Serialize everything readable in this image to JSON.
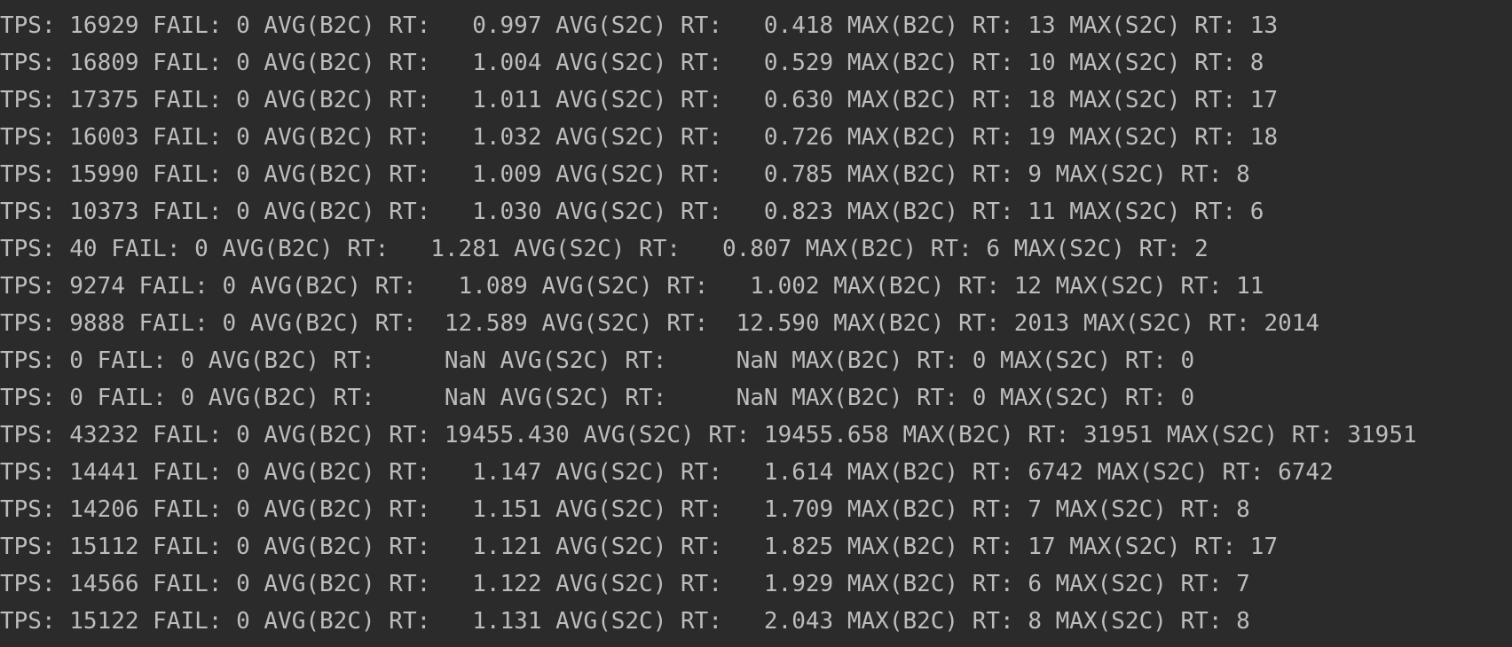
{
  "log": {
    "lines": [
      "TPS: 16929 FAIL: 0 AVG(B2C) RT:   0.997 AVG(S2C) RT:   0.418 MAX(B2C) RT: 13 MAX(S2C) RT: 13",
      "TPS: 16809 FAIL: 0 AVG(B2C) RT:   1.004 AVG(S2C) RT:   0.529 MAX(B2C) RT: 10 MAX(S2C) RT: 8",
      "TPS: 17375 FAIL: 0 AVG(B2C) RT:   1.011 AVG(S2C) RT:   0.630 MAX(B2C) RT: 18 MAX(S2C) RT: 17",
      "TPS: 16003 FAIL: 0 AVG(B2C) RT:   1.032 AVG(S2C) RT:   0.726 MAX(B2C) RT: 19 MAX(S2C) RT: 18",
      "TPS: 15990 FAIL: 0 AVG(B2C) RT:   1.009 AVG(S2C) RT:   0.785 MAX(B2C) RT: 9 MAX(S2C) RT: 8",
      "TPS: 10373 FAIL: 0 AVG(B2C) RT:   1.030 AVG(S2C) RT:   0.823 MAX(B2C) RT: 11 MAX(S2C) RT: 6",
      "TPS: 40 FAIL: 0 AVG(B2C) RT:   1.281 AVG(S2C) RT:   0.807 MAX(B2C) RT: 6 MAX(S2C) RT: 2",
      "TPS: 9274 FAIL: 0 AVG(B2C) RT:   1.089 AVG(S2C) RT:   1.002 MAX(B2C) RT: 12 MAX(S2C) RT: 11",
      "TPS: 9888 FAIL: 0 AVG(B2C) RT:  12.589 AVG(S2C) RT:  12.590 MAX(B2C) RT: 2013 MAX(S2C) RT: 2014",
      "TPS: 0 FAIL: 0 AVG(B2C) RT:     NaN AVG(S2C) RT:     NaN MAX(B2C) RT: 0 MAX(S2C) RT: 0",
      "TPS: 0 FAIL: 0 AVG(B2C) RT:     NaN AVG(S2C) RT:     NaN MAX(B2C) RT: 0 MAX(S2C) RT: 0",
      "TPS: 43232 FAIL: 0 AVG(B2C) RT: 19455.430 AVG(S2C) RT: 19455.658 MAX(B2C) RT: 31951 MAX(S2C) RT: 31951",
      "TPS: 14441 FAIL: 0 AVG(B2C) RT:   1.147 AVG(S2C) RT:   1.614 MAX(B2C) RT: 6742 MAX(S2C) RT: 6742",
      "TPS: 14206 FAIL: 0 AVG(B2C) RT:   1.151 AVG(S2C) RT:   1.709 MAX(B2C) RT: 7 MAX(S2C) RT: 8",
      "TPS: 15112 FAIL: 0 AVG(B2C) RT:   1.121 AVG(S2C) RT:   1.825 MAX(B2C) RT: 17 MAX(S2C) RT: 17",
      "TPS: 14566 FAIL: 0 AVG(B2C) RT:   1.122 AVG(S2C) RT:   1.929 MAX(B2C) RT: 6 MAX(S2C) RT: 7",
      "TPS: 15122 FAIL: 0 AVG(B2C) RT:   1.131 AVG(S2C) RT:   2.043 MAX(B2C) RT: 8 MAX(S2C) RT: 8"
    ]
  },
  "colors": {
    "background": "#2b2b2b",
    "text": "#bdbdbd"
  }
}
